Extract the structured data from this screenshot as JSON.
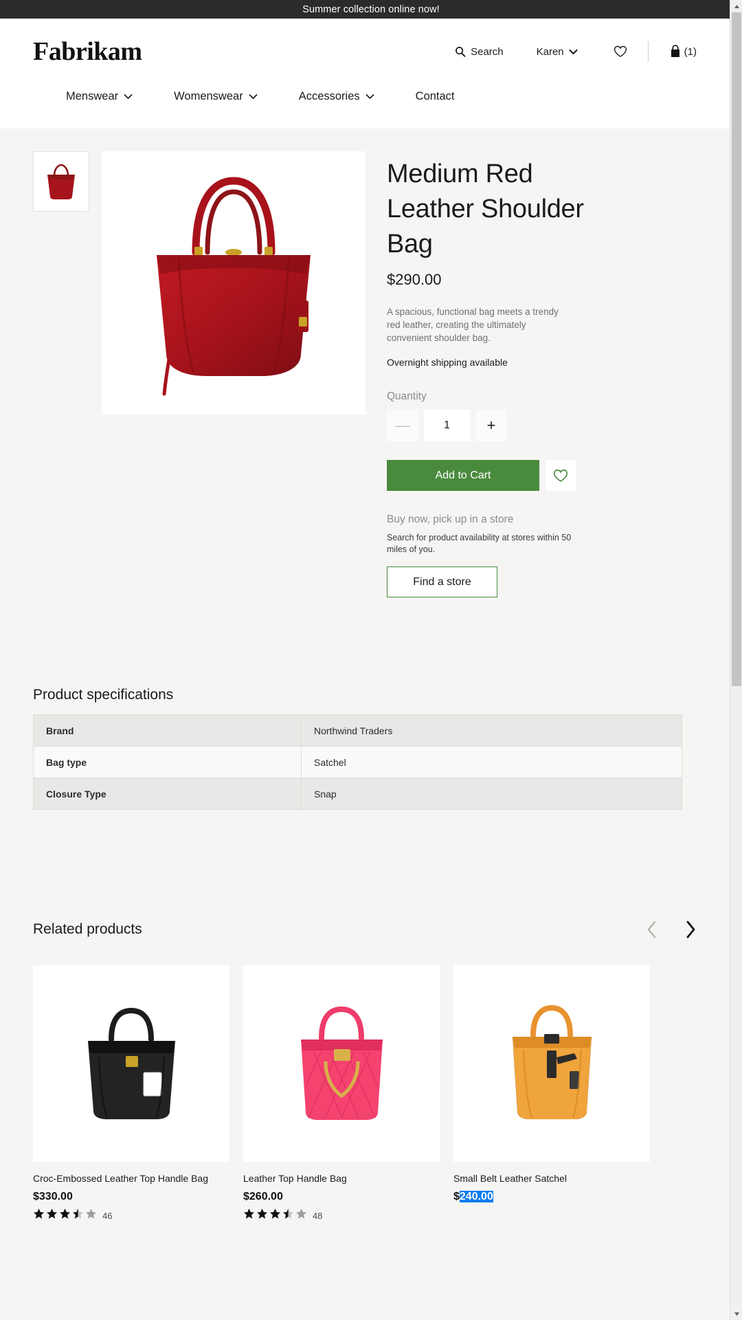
{
  "announcement": {
    "text": "Summer collection online now!"
  },
  "header": {
    "logo": "Fabrikam",
    "search_label": "Search",
    "account_label": "Karen",
    "cart_count": "(1)",
    "icons": {
      "search": "search-icon",
      "chevron": "chevron-down-icon",
      "wishlist": "heart-outline-icon",
      "cart": "shopping-bag-icon"
    }
  },
  "nav": {
    "items": [
      {
        "label": "Menswear",
        "has_chevron": true
      },
      {
        "label": "Womenswear",
        "has_chevron": true
      },
      {
        "label": "Accessories",
        "has_chevron": true
      },
      {
        "label": "Contact",
        "has_chevron": false
      }
    ]
  },
  "product": {
    "title": "Medium Red Leather Shoulder Bag",
    "price": "$290.00",
    "description": "A spacious, functional bag meets a trendy red leather, creating the ultimately convenient shoulder bag.",
    "shipping_note": "Overnight shipping available",
    "quantity_label": "Quantity",
    "quantity_value": "1",
    "decrease_label": "—",
    "increase_label": "+",
    "add_to_cart_label": "Add to Cart",
    "wishlist_icon": "heart-outline-icon",
    "accent_color": "#4a8a3d",
    "thumbnail_alt": "red-shoulder-bag-thumbnail",
    "hero_alt": "red-shoulder-bag-main-image"
  },
  "pickup": {
    "title": "Buy now, pick up in a store",
    "description": "Search for product availability at stores within 50 miles of you.",
    "button_label": "Find a store"
  },
  "specifications": {
    "title": "Product specifications",
    "rows": [
      {
        "key": "Brand",
        "value": "Northwind Traders"
      },
      {
        "key": "Bag type",
        "value": "Satchel"
      },
      {
        "key": "Closure Type",
        "value": "Snap"
      }
    ]
  },
  "related": {
    "title": "Related products",
    "prev_icon": "chevron-left-icon",
    "next_icon": "chevron-right-icon",
    "prev_enabled": false,
    "next_enabled": true,
    "products": [
      {
        "name": "Croc-Embossed Leather Top Handle Bag",
        "price": "$330.00",
        "price_prefix": "$330.00",
        "price_selected": "",
        "rating": 3.5,
        "review_count": "46",
        "image_alt": "black-croc-embossed-handbag"
      },
      {
        "name": "Leather Top Handle Bag",
        "price": "$260.00",
        "price_prefix": "$260.00",
        "price_selected": "",
        "rating": 3.5,
        "review_count": "48",
        "image_alt": "pink-quilted-handbag"
      },
      {
        "name": "Small Belt Leather Satchel",
        "price": "$240.00",
        "price_prefix": "$",
        "price_selected": "240.00",
        "rating": 0,
        "review_count": "",
        "image_alt": "orange-belt-satchel"
      }
    ]
  },
  "selection_highlight_color": "#0a7cf0",
  "scrollbar": {
    "up_icon": "scroll-up-arrow",
    "down_icon": "scroll-down-arrow"
  }
}
